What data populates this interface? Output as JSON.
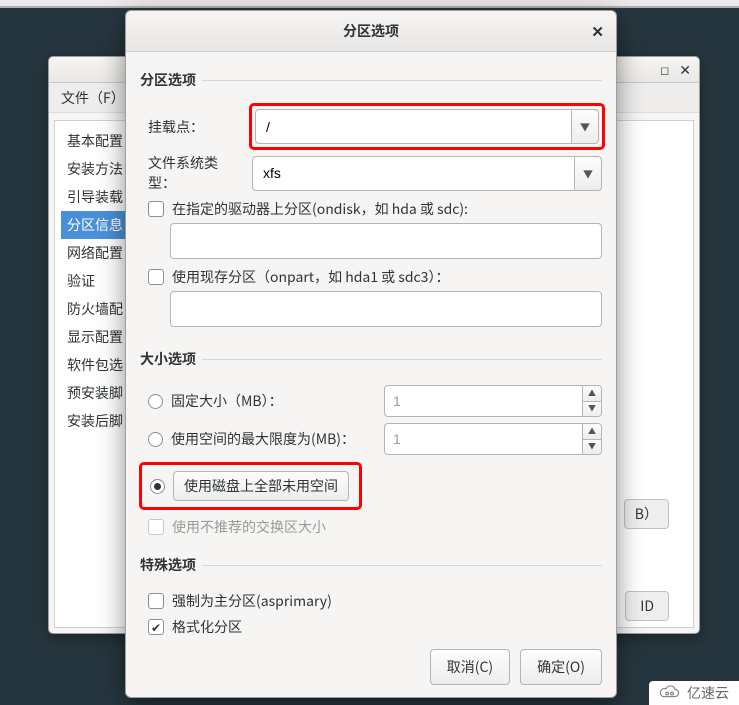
{
  "parent": {
    "menu_file": "文件（F）",
    "nav": [
      "基本配置",
      "安装方法",
      "引导装载",
      "分区信息",
      "网络配置",
      "验证",
      "防火墙配",
      "显示配置",
      "软件包选",
      "预安装脚",
      "安装后脚"
    ],
    "nav_selected_index": 3,
    "btn_b": "B）",
    "btn_id": "ID"
  },
  "dialog": {
    "title": "分区选项",
    "section_partition": "分区选项",
    "mount_label": "挂载点：",
    "mount_value": "/",
    "fs_label": "文件系统类型：",
    "fs_value": "xfs",
    "chk_ondisk": "在指定的驱动器上分区(ondisk，如 hda 或 sdc):",
    "chk_onpart": "使用现存分区（onpart，如 hda1 或 sdc3）：",
    "section_size": "大小选项",
    "radio_fixed": "固定大小（MB）：",
    "radio_max": "使用空间的最大限度为(MB)：",
    "radio_all": "使用磁盘上全部未用空间",
    "chk_swap": "使用不推荐的交换区大小",
    "spin_fixed_value": "1",
    "spin_max_value": "1",
    "section_special": "特殊选项",
    "chk_asprimary": "强制为主分区(asprimary)",
    "chk_format": "格式化分区",
    "btn_cancel": "取消(C)",
    "btn_ok": "确定(O)"
  },
  "watermark": "亿速云"
}
